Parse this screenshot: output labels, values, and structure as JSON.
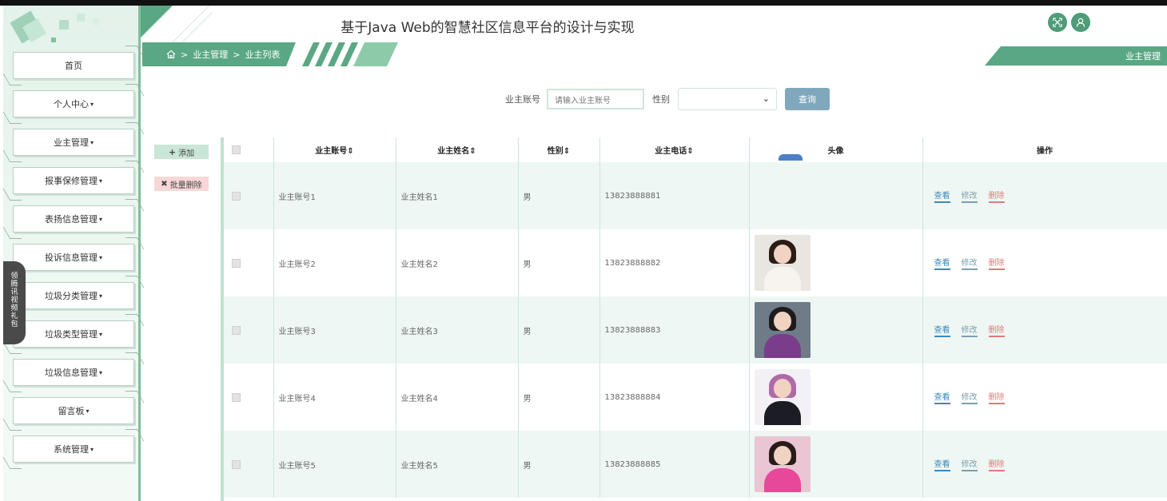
{
  "app": {
    "title": "基于Java Web的智慧社区信息平台的设计与实现"
  },
  "breadcrumb": {
    "items": [
      "业主管理",
      "业主列表"
    ],
    "separator": ">"
  },
  "header": {
    "right_label": "业主管理",
    "icons": [
      "fullscreen-icon",
      "user-icon"
    ]
  },
  "sidebar": {
    "items": [
      {
        "label": "首页",
        "caret": false
      },
      {
        "label": "个人中心",
        "caret": true
      },
      {
        "label": "业主管理",
        "caret": true
      },
      {
        "label": "报事保修管理",
        "caret": true
      },
      {
        "label": "表扬信息管理",
        "caret": true
      },
      {
        "label": "投诉信息管理",
        "caret": true
      },
      {
        "label": "垃圾分类管理",
        "caret": true
      },
      {
        "label": "垃圾类型管理",
        "caret": true
      },
      {
        "label": "垃圾信息管理",
        "caret": true
      },
      {
        "label": "留言板",
        "caret": true
      },
      {
        "label": "系统管理",
        "caret": true
      }
    ],
    "caret_glyph": "▾",
    "float_tab": [
      "领",
      "腾",
      "讯",
      "视",
      "频",
      "礼",
      "包"
    ]
  },
  "search": {
    "account_label": "业主账号",
    "account_placeholder": "请输入业主账号",
    "gender_label": "性别",
    "gender_value": "",
    "query_label": "查询"
  },
  "actions": {
    "add_label": "添加",
    "add_icon": "plus-icon",
    "batch_delete_label": "批量删除",
    "batch_delete_icon": "times-icon"
  },
  "table": {
    "columns": [
      "业主账号",
      "业主姓名",
      "性别",
      "业主电话",
      "头像",
      "操作"
    ],
    "sort_glyph": "⇕",
    "op_labels": {
      "view": "查看",
      "edit": "修改",
      "delete": "删除"
    },
    "rows": [
      {
        "account": "业主账号1",
        "name": "业主姓名1",
        "gender": "男",
        "phone": "13823888881",
        "avatar": "cropped"
      },
      {
        "account": "业主账号2",
        "name": "业主姓名2",
        "gender": "男",
        "phone": "13823888882",
        "avatar": "woman-white-dress"
      },
      {
        "account": "业主账号3",
        "name": "业主姓名3",
        "gender": "男",
        "phone": "13823888883",
        "avatar": "man-purple-shirt"
      },
      {
        "account": "业主账号4",
        "name": "业主姓名4",
        "gender": "男",
        "phone": "13823888884",
        "avatar": "woman-pink-hair"
      },
      {
        "account": "业主账号5",
        "name": "业主姓名5",
        "gender": "男",
        "phone": "13823888885",
        "avatar": "woman-pink-hoodie"
      }
    ]
  },
  "colors": {
    "accent": "#4e9c78",
    "sidebar_bg": "#e3f2ea",
    "row_alt": "#eef7f3",
    "view": "#3d89b8",
    "delete": "#e07a7a"
  }
}
